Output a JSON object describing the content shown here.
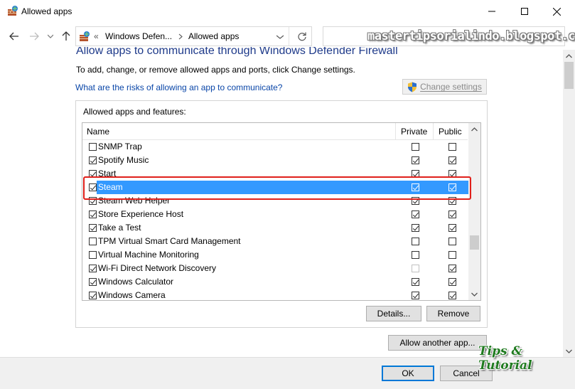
{
  "window": {
    "title": "Allowed apps",
    "controls": {
      "minimize": "minimize-icon",
      "maximize": "maximize-icon",
      "close": "close-icon"
    }
  },
  "address": {
    "overflow": "«",
    "crumbs": [
      "Windows Defen...",
      "Allowed apps"
    ],
    "search_placeholder": ""
  },
  "watermark": "mastertipsorialindo.blogspot.com",
  "content": {
    "heading": "Allow apps to communicate through Windows Defender Firewall",
    "description": "To add, change, or remove allowed apps and ports, click Change settings.",
    "risk_link": "What are the risks of allowing an app to communicate?",
    "change_settings": "Change settings",
    "group_label": "Allowed apps and features:"
  },
  "table": {
    "columns": [
      "Name",
      "Private",
      "Public"
    ],
    "rows": [
      {
        "name": "SNMP Trap",
        "enabled": false,
        "private": false,
        "public": false,
        "selected": false
      },
      {
        "name": "Spotify Music",
        "enabled": true,
        "private": true,
        "public": true,
        "selected": false
      },
      {
        "name": "Start",
        "enabled": true,
        "private": true,
        "public": true,
        "selected": false
      },
      {
        "name": "Steam",
        "enabled": true,
        "private": true,
        "public": true,
        "selected": true
      },
      {
        "name": "Steam Web Helper",
        "enabled": true,
        "private": true,
        "public": true,
        "selected": false
      },
      {
        "name": "Store Experience Host",
        "enabled": true,
        "private": true,
        "public": true,
        "selected": false
      },
      {
        "name": "Take a Test",
        "enabled": true,
        "private": true,
        "public": true,
        "selected": false
      },
      {
        "name": "TPM Virtual Smart Card Management",
        "enabled": false,
        "private": false,
        "public": false,
        "selected": false
      },
      {
        "name": "Virtual Machine Monitoring",
        "enabled": false,
        "private": false,
        "public": false,
        "selected": false
      },
      {
        "name": "Wi-Fi Direct Network Discovery",
        "enabled": true,
        "private": false,
        "private_disabled": true,
        "public": true,
        "selected": false
      },
      {
        "name": "Windows Calculator",
        "enabled": true,
        "private": true,
        "public": true,
        "selected": false
      },
      {
        "name": "Windows Camera",
        "enabled": true,
        "private": true,
        "public": true,
        "selected": false
      }
    ]
  },
  "buttons": {
    "details": "Details...",
    "remove": "Remove",
    "allow_another": "Allow another app...",
    "ok": "OK",
    "cancel": "Cancel"
  },
  "logo_text": "Tips & Tutorial",
  "colors": {
    "selection": "#3399ff",
    "highlight_box": "#e0201b",
    "heading": "#1e3a8a",
    "link": "#0a46a8"
  }
}
